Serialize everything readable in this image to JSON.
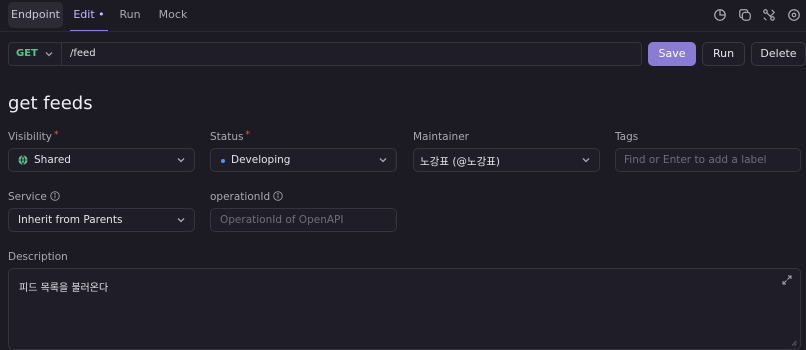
{
  "tabs": [
    {
      "label": "Endpoint"
    },
    {
      "label": "Edit •"
    },
    {
      "label": "Run"
    },
    {
      "label": "Mock"
    }
  ],
  "toolbar_icons": [
    "history-icon",
    "copy-icon",
    "tools-icon",
    "settings-icon"
  ],
  "request": {
    "method": "GET",
    "path": "/feed"
  },
  "actions": {
    "save": "Save",
    "run": "Run",
    "delete": "Delete"
  },
  "title": "get feeds",
  "fields": {
    "visibility": {
      "label": "Visibility",
      "required": "*",
      "value": "Shared"
    },
    "status": {
      "label": "Status",
      "required": "*",
      "value": "Developing"
    },
    "maintainer": {
      "label": "Maintainer",
      "value": "노강표 (@노강표)"
    },
    "tags": {
      "label": "Tags",
      "placeholder": "Find or Enter to add a label"
    },
    "service": {
      "label": "Service",
      "value": "Inherit from Parents"
    },
    "operation_id": {
      "label": "operationId",
      "placeholder": "OperationId of OpenAPI"
    }
  },
  "description": {
    "label": "Description",
    "value": "피드 목록을 불러온다"
  },
  "colors": {
    "accent": "#8a7bd6",
    "method_get": "#5bc487",
    "status_dot": "#5e8ef0",
    "required": "#e0605f"
  }
}
